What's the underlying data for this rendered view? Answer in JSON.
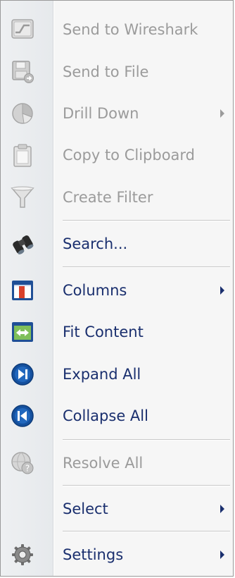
{
  "menu": {
    "items": [
      {
        "label": "Send to Wireshark",
        "icon": "wireshark-icon",
        "enabled": false,
        "submenu": false
      },
      {
        "label": "Send to File",
        "icon": "floppy-disk-icon",
        "enabled": false,
        "submenu": false
      },
      {
        "label": "Drill Down",
        "icon": "pie-chart-icon",
        "enabled": false,
        "submenu": true
      },
      {
        "label": "Copy to Clipboard",
        "icon": "clipboard-icon",
        "enabled": false,
        "submenu": false
      },
      {
        "label": "Create Filter",
        "icon": "funnel-icon",
        "enabled": false,
        "submenu": false
      },
      {
        "label": "Search...",
        "icon": "binoculars-icon",
        "enabled": true,
        "submenu": false
      },
      {
        "label": "Columns",
        "icon": "columns-icon",
        "enabled": true,
        "submenu": true
      },
      {
        "label": "Fit Content",
        "icon": "fit-content-icon",
        "enabled": true,
        "submenu": false
      },
      {
        "label": "Expand All",
        "icon": "expand-all-icon",
        "enabled": true,
        "submenu": false
      },
      {
        "label": "Collapse All",
        "icon": "collapse-all-icon",
        "enabled": true,
        "submenu": false
      },
      {
        "label": "Resolve All",
        "icon": "resolve-globe-icon",
        "enabled": false,
        "submenu": false
      },
      {
        "label": "Select",
        "icon": "",
        "enabled": true,
        "submenu": true
      },
      {
        "label": "Settings",
        "icon": "gear-icon",
        "enabled": true,
        "submenu": true
      }
    ]
  },
  "colors": {
    "enabled_text": "#1a2f6e",
    "disabled_text": "#9b9b9b",
    "menu_background": "#f6f6f6",
    "gutter": "#eceef0"
  }
}
